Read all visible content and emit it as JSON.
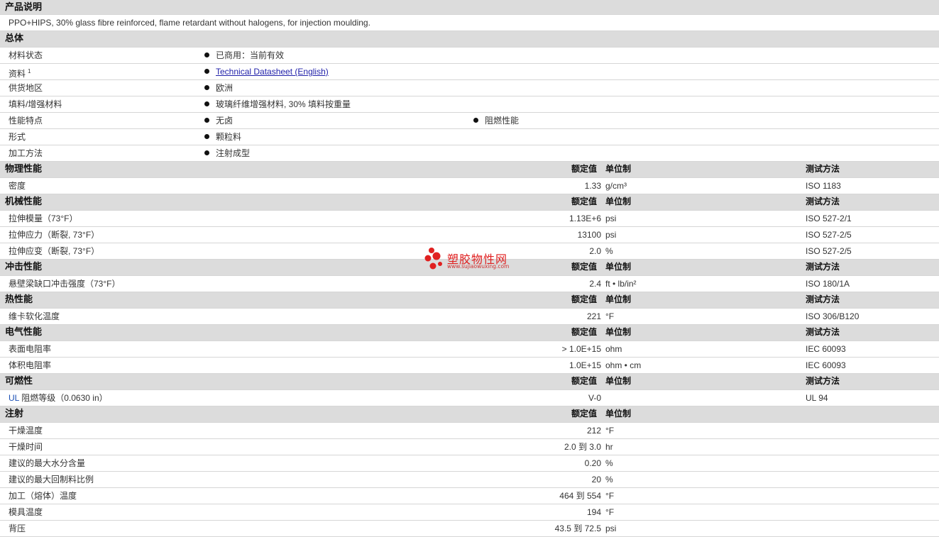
{
  "sections": {
    "desc": {
      "title": "产品说明",
      "text": "PPO+HIPS, 30% glass fibre reinforced, flame retardant without halogens, for injection moulding."
    },
    "general": {
      "title": "总体",
      "rows": [
        {
          "name": "材料状态",
          "b1": "已商用：当前有效"
        },
        {
          "name": "资料",
          "sup": "1",
          "link": "Technical Datasheet (English)"
        },
        {
          "name": "供货地区",
          "b1": "欧洲"
        },
        {
          "name": "填料/增强材料",
          "b1": "玻璃纤维增强材料, 30% 填料按重量"
        },
        {
          "name": "性能特点",
          "b1": "无卤",
          "b2": "阻燃性能"
        },
        {
          "name": "形式",
          "b1": "颗粒料"
        },
        {
          "name": "加工方法",
          "b1": "注射成型"
        }
      ]
    },
    "headers": {
      "val": "额定值",
      "unit": "单位制",
      "test": "测试方法"
    },
    "physical": {
      "title": "物理性能",
      "rows": [
        {
          "name": "密度",
          "val": "1.33",
          "unit": "g/cm³",
          "test": "ISO 1183"
        }
      ]
    },
    "mechanical": {
      "title": "机械性能",
      "rows": [
        {
          "name": "拉伸模量（73°F）",
          "val": "1.13E+6",
          "unit": "psi",
          "test": "ISO 527-2/1"
        },
        {
          "name": "拉伸应力（断裂, 73°F）",
          "val": "13100",
          "unit": "psi",
          "test": "ISO 527-2/5"
        },
        {
          "name": "拉伸应变（断裂, 73°F）",
          "val": "2.0",
          "unit": "%",
          "test": "ISO 527-2/5"
        }
      ]
    },
    "impact": {
      "title": "冲击性能",
      "rows": [
        {
          "name": "悬壁梁缺口冲击强度（73°F）",
          "val": "2.4",
          "unit": "ft • lb/in²",
          "test": "ISO 180/1A"
        }
      ]
    },
    "thermal": {
      "title": "热性能",
      "rows": [
        {
          "name": "维卡软化温度",
          "val": "221",
          "unit": "°F",
          "test": "ISO 306/B120"
        }
      ]
    },
    "electrical": {
      "title": "电气性能",
      "rows": [
        {
          "name": "表面电阻率",
          "val": "> 1.0E+15",
          "unit": "ohm",
          "test": "IEC 60093"
        },
        {
          "name": "体积电阻率",
          "val": "1.0E+15",
          "unit": "ohm • cm",
          "test": "IEC 60093"
        }
      ]
    },
    "flammability": {
      "title": "可燃性",
      "rows": [
        {
          "name_ul": "UL",
          "name": " 阻燃等级（0.0630 in）",
          "val": "V-0",
          "unit": "",
          "test": "UL 94"
        }
      ]
    },
    "injection": {
      "title": "注射",
      "rows": [
        {
          "name": "干燥温度",
          "val": "212",
          "unit": "°F"
        },
        {
          "name": "干燥时间",
          "val": "2.0 到  3.0",
          "unit": "hr"
        },
        {
          "name": "建议的最大水分含量",
          "val": "0.20",
          "unit": "%"
        },
        {
          "name": "建议的最大回制料比例",
          "val": "20",
          "unit": "%"
        },
        {
          "name": "加工（熔体）温度",
          "val": "464 到  554",
          "unit": "°F"
        },
        {
          "name": "模具温度",
          "val": "194",
          "unit": "°F"
        },
        {
          "name": "背压",
          "val": "43.5 到  72.5",
          "unit": "psi"
        }
      ]
    }
  },
  "watermark": {
    "name": "塑胶物性网",
    "url": "www.sujiaowuxing.com"
  }
}
